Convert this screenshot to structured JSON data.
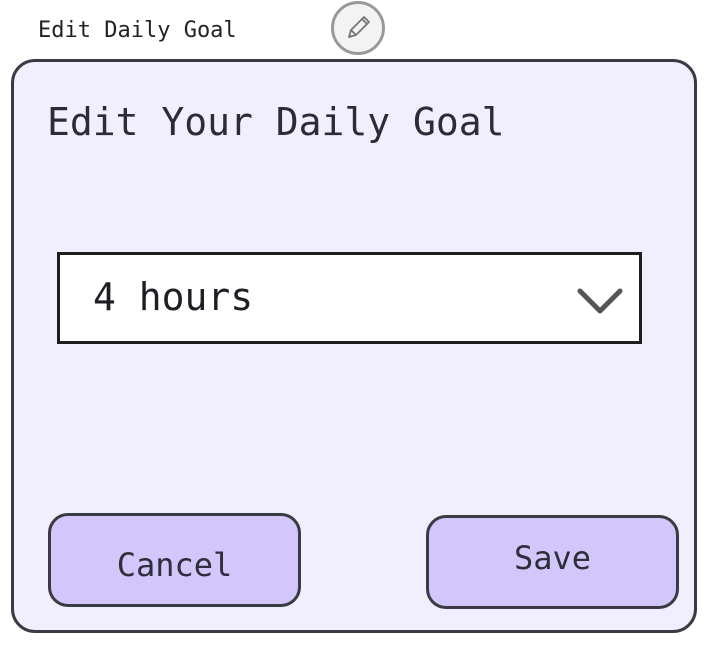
{
  "header": {
    "caption": "Edit Daily Goal",
    "edit_icon": "pencil-icon"
  },
  "dialog": {
    "title": "Edit Your Daily Goal",
    "goal_select": {
      "selected": "4 hours",
      "icon": "chevron-down-icon"
    },
    "buttons": {
      "cancel_label": "Cancel",
      "save_label": "Save"
    }
  },
  "colors": {
    "dialog_background": "#f1effd",
    "button_background": "#d2c6fb",
    "border": "#3a3a42"
  }
}
